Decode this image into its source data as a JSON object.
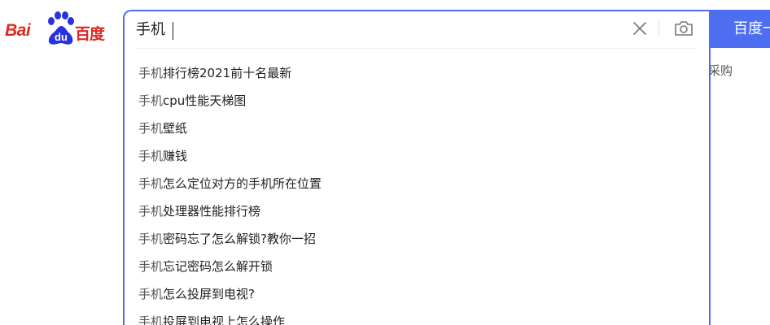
{
  "logo": {
    "latin": "Bai",
    "paw_text": "du",
    "cn": "百度",
    "color": "#de2a1f",
    "paw_color": "#2932e1"
  },
  "search": {
    "value": "手机",
    "clear_icon": "close-icon",
    "camera_icon": "camera-icon",
    "border_color": "#4e6ef2",
    "button_label": "百度一下"
  },
  "suggestions": [
    {
      "query": "手机",
      "rest": "排行榜2021前十名最新"
    },
    {
      "query": "手机",
      "rest": "cpu性能天梯图"
    },
    {
      "query": "手机",
      "rest": "壁纸"
    },
    {
      "query": "手机",
      "rest": "赚钱"
    },
    {
      "query": "手机",
      "rest": "怎么定位对方的手机所在位置"
    },
    {
      "query": "手机",
      "rest": "处理器性能排行榜"
    },
    {
      "query": "手机",
      "rest": "密码忘了怎么解锁?教你一招"
    },
    {
      "query": "手机",
      "rest": "忘记密码怎么解开锁"
    },
    {
      "query": "手机",
      "rest": "怎么投屏到电视?"
    },
    {
      "query": "手机",
      "rest": "投屏到电视上怎么操作"
    }
  ],
  "behind": {
    "text": "采购"
  }
}
